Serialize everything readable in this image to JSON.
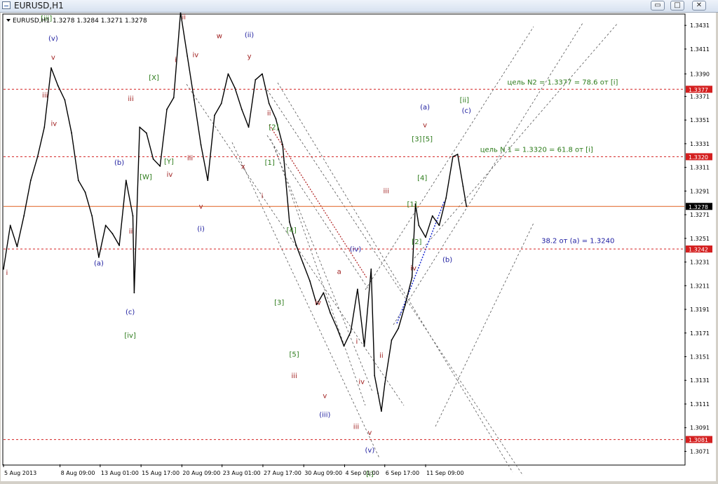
{
  "window": {
    "title": "EURUSD,H1",
    "buttons": {
      "minimize": "▭",
      "maximize": "□",
      "close": "✕"
    }
  },
  "chart_header": {
    "symbol": "EURUSD,H1",
    "ohlc": "1.3278 1.3284 1.3271 1.3278"
  },
  "chart_data": {
    "type": "line",
    "title": "EURUSD,H1",
    "ylim": [
      1.306,
      1.344
    ],
    "xlim": [
      0,
      100
    ],
    "y_ticks": [
      "1.3431",
      "1.3411",
      "1.3390",
      "1.3371",
      "1.3351",
      "1.3331",
      "1.3311",
      "1.3291",
      "1.3271",
      "1.3251",
      "1.3231",
      "1.3211",
      "1.3191",
      "1.3171",
      "1.3151",
      "1.3131",
      "1.3111",
      "1.3091",
      "1.3071"
    ],
    "x_ticks": [
      {
        "label": "5 Aug 2013",
        "x": 0
      },
      {
        "label": "8 Aug 09:00",
        "x": 8.3
      },
      {
        "label": "13 Aug 01:00",
        "x": 14.2
      },
      {
        "label": "15 Aug 17:00",
        "x": 20.2
      },
      {
        "label": "20 Aug 09:00",
        "x": 26.2
      },
      {
        "label": "23 Aug 01:00",
        "x": 32.1
      },
      {
        "label": "27 Aug 17:00",
        "x": 38.1
      },
      {
        "label": "30 Aug 09:00",
        "x": 44.1
      },
      {
        "label": "4 Sep 01:00",
        "x": 50.1
      },
      {
        "label": "6 Sep 17:00",
        "x": 56.0
      },
      {
        "label": "11 Sep 09:00",
        "x": 62.0
      }
    ],
    "series": [
      {
        "values": [
          [
            0,
            1.3225
          ],
          [
            1,
            1.3262
          ],
          [
            2,
            1.3244
          ],
          [
            3,
            1.327
          ],
          [
            4,
            1.33
          ],
          [
            5,
            1.332
          ],
          [
            6,
            1.3345
          ],
          [
            7,
            1.3395
          ],
          [
            8,
            1.338
          ],
          [
            9,
            1.3368
          ],
          [
            10,
            1.334
          ],
          [
            11,
            1.33
          ],
          [
            12,
            1.329
          ],
          [
            13,
            1.327
          ],
          [
            14,
            1.3235
          ],
          [
            15,
            1.3262
          ],
          [
            16,
            1.3255
          ],
          [
            17,
            1.3245
          ],
          [
            18,
            1.33
          ],
          [
            19,
            1.327
          ],
          [
            19.2,
            1.3205
          ],
          [
            20,
            1.3345
          ],
          [
            21,
            1.334
          ],
          [
            22,
            1.3318
          ],
          [
            23,
            1.3312
          ],
          [
            24,
            1.336
          ],
          [
            25,
            1.337
          ],
          [
            26,
            1.3442
          ],
          [
            27,
            1.3405
          ],
          [
            28,
            1.3368
          ],
          [
            29,
            1.333
          ],
          [
            30,
            1.33
          ],
          [
            31,
            1.3355
          ],
          [
            32,
            1.3365
          ],
          [
            33,
            1.339
          ],
          [
            34,
            1.3378
          ],
          [
            35,
            1.336
          ],
          [
            36,
            1.3345
          ],
          [
            37,
            1.3385
          ],
          [
            38,
            1.339
          ],
          [
            39,
            1.3365
          ],
          [
            40,
            1.3352
          ],
          [
            41,
            1.333
          ],
          [
            42,
            1.3265
          ],
          [
            43,
            1.3245
          ],
          [
            44,
            1.323
          ],
          [
            45,
            1.3215
          ],
          [
            46,
            1.3195
          ],
          [
            47,
            1.3205
          ],
          [
            48,
            1.3188
          ],
          [
            49,
            1.3175
          ],
          [
            50,
            1.316
          ],
          [
            51,
            1.3172
          ],
          [
            52,
            1.3208
          ],
          [
            53,
            1.316
          ],
          [
            54,
            1.3225
          ],
          [
            54.5,
            1.3135
          ],
          [
            55,
            1.312
          ],
          [
            55.5,
            1.3105
          ],
          [
            56,
            1.3128
          ],
          [
            57,
            1.3165
          ],
          [
            58,
            1.3175
          ],
          [
            59,
            1.3195
          ],
          [
            60,
            1.3218
          ],
          [
            60.5,
            1.328
          ],
          [
            61,
            1.3262
          ],
          [
            62,
            1.3252
          ],
          [
            63,
            1.327
          ],
          [
            64,
            1.3262
          ],
          [
            65,
            1.3285
          ],
          [
            66,
            1.332
          ],
          [
            66.7,
            1.3322
          ],
          [
            67.5,
            1.3295
          ],
          [
            68,
            1.3278
          ]
        ]
      }
    ],
    "horizontal_lines": [
      {
        "label": "1.3377",
        "y": 1.3377,
        "color": "#d42020"
      },
      {
        "label": "1.3320",
        "y": 1.332,
        "color": "#d42020"
      },
      {
        "label": "1.3278",
        "y": 1.3278,
        "color": "#e06020",
        "badge": "#000000"
      },
      {
        "label": "1.3242",
        "y": 1.3242,
        "color": "#d42020"
      },
      {
        "label": "1.3081",
        "y": 1.3081,
        "color": "#d42020"
      }
    ],
    "annotations": [
      {
        "text": "цель N2 = 1.3377 =  78.6 от [i]",
        "x": 74,
        "y": 1.3381,
        "color": "#2a7a18"
      },
      {
        "text": "цель N 1 = 1.3320 = 61.8 от [i]",
        "x": 70,
        "y": 1.3324,
        "color": "#2a7a18"
      },
      {
        "text": "38.2 от (a) = 1.3240",
        "x": 79,
        "y": 1.3247,
        "color": "#1a1aa0"
      }
    ],
    "wave_labels": [
      {
        "t": "[iii]",
        "x": 6.3,
        "y": 1.3435,
        "c": "#2a7a18"
      },
      {
        "t": "(v)",
        "x": 7.3,
        "y": 1.3418,
        "c": "#2020a0"
      },
      {
        "t": "v",
        "x": 7.3,
        "y": 1.3402,
        "c": "#a02020"
      },
      {
        "t": "iii",
        "x": 6.1,
        "y": 1.337,
        "c": "#a02020"
      },
      {
        "t": "iv",
        "x": 7.4,
        "y": 1.3346,
        "c": "#a02020"
      },
      {
        "t": "i",
        "x": 0.5,
        "y": 1.322,
        "c": "#a02020"
      },
      {
        "t": "(a)",
        "x": 14.0,
        "y": 1.3228,
        "c": "#2020a0"
      },
      {
        "t": "(b)",
        "x": 17.0,
        "y": 1.3313,
        "c": "#2020a0"
      },
      {
        "t": "ii",
        "x": 18.7,
        "y": 1.3255,
        "c": "#a02020"
      },
      {
        "t": "(c)",
        "x": 18.6,
        "y": 1.3187,
        "c": "#2020a0"
      },
      {
        "t": "[iv]",
        "x": 18.6,
        "y": 1.3167,
        "c": "#2a7a18"
      },
      {
        "t": "iii",
        "x": 18.7,
        "y": 1.3367,
        "c": "#a02020"
      },
      {
        "t": "[X]",
        "x": 22.1,
        "y": 1.3385,
        "c": "#2a7a18"
      },
      {
        "t": "[W]",
        "x": 20.9,
        "y": 1.3301,
        "c": "#2a7a18"
      },
      {
        "t": "[Y]",
        "x": 24.3,
        "y": 1.3314,
        "c": "#2a7a18"
      },
      {
        "t": "iv",
        "x": 24.4,
        "y": 1.3303,
        "c": "#a02020"
      },
      {
        "t": "ii",
        "x": 26.5,
        "y": 1.3436,
        "c": "#a02020"
      },
      {
        "t": "i",
        "x": 25.3,
        "y": 1.34,
        "c": "#a02020"
      },
      {
        "t": "iv",
        "x": 28.2,
        "y": 1.3404,
        "c": "#a02020"
      },
      {
        "t": "iii",
        "x": 27.4,
        "y": 1.3317,
        "c": "#a02020"
      },
      {
        "t": "v",
        "x": 29.0,
        "y": 1.3276,
        "c": "#a02020"
      },
      {
        "t": "(i)",
        "x": 29.0,
        "y": 1.3257,
        "c": "#2020a0"
      },
      {
        "t": "w",
        "x": 31.7,
        "y": 1.342,
        "c": "#a02020"
      },
      {
        "t": "(ii)",
        "x": 36.1,
        "y": 1.3421,
        "c": "#2020a0"
      },
      {
        "t": "y",
        "x": 36.1,
        "y": 1.3403,
        "c": "#a02020"
      },
      {
        "t": "x",
        "x": 35.2,
        "y": 1.331,
        "c": "#a02020"
      },
      {
        "t": "ii",
        "x": 39.0,
        "y": 1.3355,
        "c": "#a02020"
      },
      {
        "t": "[2]",
        "x": 39.7,
        "y": 1.3343,
        "c": "#2a7a18"
      },
      {
        "t": "[1]",
        "x": 39.1,
        "y": 1.3313,
        "c": "#2a7a18"
      },
      {
        "t": "i",
        "x": 38.0,
        "y": 1.3285,
        "c": "#a02020"
      },
      {
        "t": "[4]",
        "x": 42.3,
        "y": 1.3256,
        "c": "#2a7a18"
      },
      {
        "t": "[3]",
        "x": 40.5,
        "y": 1.3195,
        "c": "#2a7a18"
      },
      {
        "t": "[5]",
        "x": 42.7,
        "y": 1.3151,
        "c": "#2a7a18"
      },
      {
        "t": "iii",
        "x": 42.7,
        "y": 1.3133,
        "c": "#a02020"
      },
      {
        "t": "iv",
        "x": 46.2,
        "y": 1.3195,
        "c": "#a02020"
      },
      {
        "t": "v",
        "x": 47.2,
        "y": 1.3116,
        "c": "#a02020"
      },
      {
        "t": "(iii)",
        "x": 47.2,
        "y": 1.31,
        "c": "#2020a0"
      },
      {
        "t": "a",
        "x": 49.3,
        "y": 1.3221,
        "c": "#a02020"
      },
      {
        "t": "(iv)",
        "x": 51.7,
        "y": 1.324,
        "c": "#2020a0"
      },
      {
        "t": "i",
        "x": 51.9,
        "y": 1.3162,
        "c": "#a02020"
      },
      {
        "t": "iv",
        "x": 52.6,
        "y": 1.3128,
        "c": "#a02020"
      },
      {
        "t": "iii",
        "x": 51.8,
        "y": 1.309,
        "c": "#a02020"
      },
      {
        "t": "v",
        "x": 53.8,
        "y": 1.3085,
        "c": "#a02020"
      },
      {
        "t": "(v)",
        "x": 53.8,
        "y": 1.307,
        "c": "#2020a0"
      },
      {
        "t": "[i]",
        "x": 53.8,
        "y": 1.305,
        "c": "#2a7a18"
      },
      {
        "t": "ii",
        "x": 55.5,
        "y": 1.315,
        "c": "#a02020"
      },
      {
        "t": "iii",
        "x": 56.2,
        "y": 1.3289,
        "c": "#a02020"
      },
      {
        "t": "[1]",
        "x": 60.0,
        "y": 1.3278,
        "c": "#2a7a18"
      },
      {
        "t": "[2]",
        "x": 60.7,
        "y": 1.3246,
        "c": "#2a7a18"
      },
      {
        "t": "iv",
        "x": 60.2,
        "y": 1.3224,
        "c": "#a02020"
      },
      {
        "t": "[3]",
        "x": 60.7,
        "y": 1.3333,
        "c": "#2a7a18"
      },
      {
        "t": "[5]",
        "x": 62.3,
        "y": 1.3333,
        "c": "#2a7a18"
      },
      {
        "t": "[4]",
        "x": 61.5,
        "y": 1.33,
        "c": "#2a7a18"
      },
      {
        "t": "(a)",
        "x": 61.9,
        "y": 1.336,
        "c": "#2020a0"
      },
      {
        "t": "v",
        "x": 61.9,
        "y": 1.3345,
        "c": "#a02020"
      },
      {
        "t": "(b)",
        "x": 65.2,
        "y": 1.3231,
        "c": "#2020a0"
      },
      {
        "t": "[ii]",
        "x": 67.7,
        "y": 1.3366,
        "c": "#2a7a18"
      },
      {
        "t": "(c)",
        "x": 68.0,
        "y": 1.3357,
        "c": "#2020a0"
      }
    ]
  }
}
